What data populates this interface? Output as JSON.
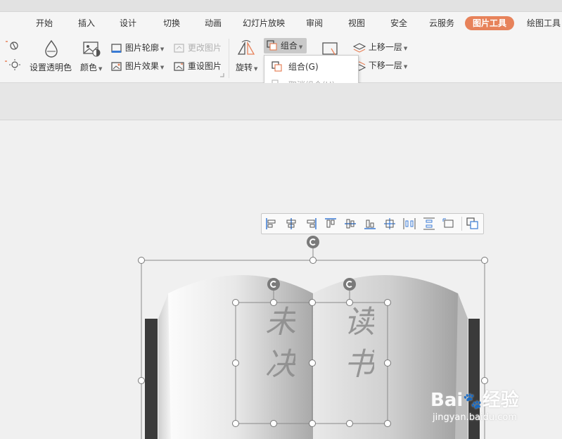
{
  "tabs": [
    {
      "label": "开始"
    },
    {
      "label": "插入"
    },
    {
      "label": "设计"
    },
    {
      "label": "切换"
    },
    {
      "label": "动画"
    },
    {
      "label": "幻灯片放映"
    },
    {
      "label": "审阅"
    },
    {
      "label": "视图"
    },
    {
      "label": "安全"
    },
    {
      "label": "云服务"
    },
    {
      "label": "图片工具",
      "active": true
    },
    {
      "label": "绘图工具"
    }
  ],
  "ribbon": {
    "set_transparent": "设置透明色",
    "color": "颜色",
    "picture_outline": "图片轮廓",
    "picture_effect": "图片效果",
    "change_picture": "更改图片",
    "reset_picture": "重设图片",
    "rotate": "旋转",
    "group": "组合",
    "bring_forward": "上移一层",
    "send_backward": "下移一层"
  },
  "group_menu": {
    "group": "组合(G)",
    "ungroup": "取消组合(U)"
  },
  "slide_text": {
    "left_page": "未决",
    "right_page": "读书"
  },
  "watermark": {
    "main": "Bai",
    "paw": "🐾",
    "suffix": "经验",
    "sub": "jingyan.baidu.com"
  },
  "colors": {
    "accent": "#e7825a"
  }
}
